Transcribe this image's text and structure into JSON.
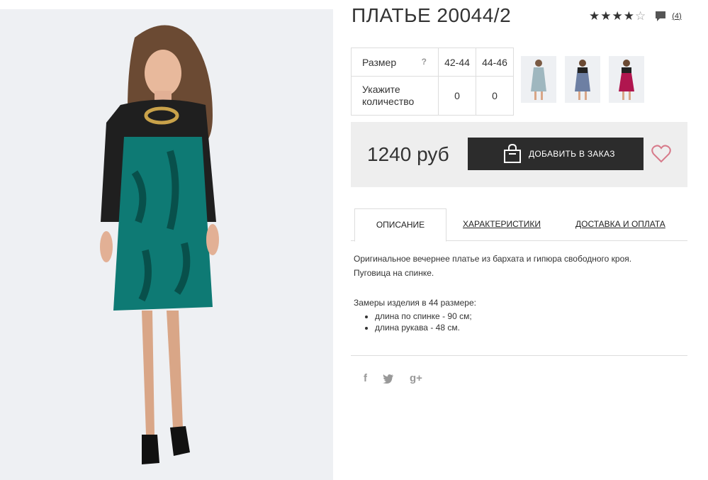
{
  "product": {
    "title": "ПЛАТЬЕ 20044/2",
    "rating": 4,
    "rating_max": 5,
    "reviews_count": "(4)"
  },
  "size_table": {
    "size_label": "Размер",
    "help_mark": "?",
    "sizes": [
      "42-44",
      "44-46"
    ],
    "qty_label": "Укажите количество",
    "quantities": [
      "0",
      "0"
    ]
  },
  "thumbnails": [
    {
      "name": "light-blue-dress-thumb",
      "color": "#9fb7bf"
    },
    {
      "name": "blue-print-dress-thumb",
      "color": "#6d7fa3"
    },
    {
      "name": "magenta-dress-thumb",
      "color": "#b0164f"
    }
  ],
  "order": {
    "price": "1240 руб",
    "add_button_label": "ДОБАВИТЬ В ЗАКАЗ",
    "icon": "shopping-bag-icon"
  },
  "tabs": [
    {
      "label": "ОПИСАНИЕ",
      "active": true
    },
    {
      "label": "ХАРАКТЕРИСТИКИ",
      "active": false
    },
    {
      "label": "ДОСТАВКА И ОПЛАТА",
      "active": false
    }
  ],
  "description": {
    "line1": "Оригинальное вечернее платье из бархата и гипюра свободного кроя.",
    "line2": "Пуговица на спинке.",
    "measure_title": "Замеры изделия в 44 размере:",
    "measures": [
      "длина по спинке - 90 см;",
      "длина рукава - 48 см."
    ]
  },
  "social": {
    "facebook": "f",
    "twitter": "🐦",
    "google_plus": "g+"
  },
  "colors": {
    "dress_teal": "#0e7a74",
    "lace_black": "#1a1a1a",
    "button_dark": "#2c2c2c",
    "heart_pink": "#d77a8a"
  }
}
